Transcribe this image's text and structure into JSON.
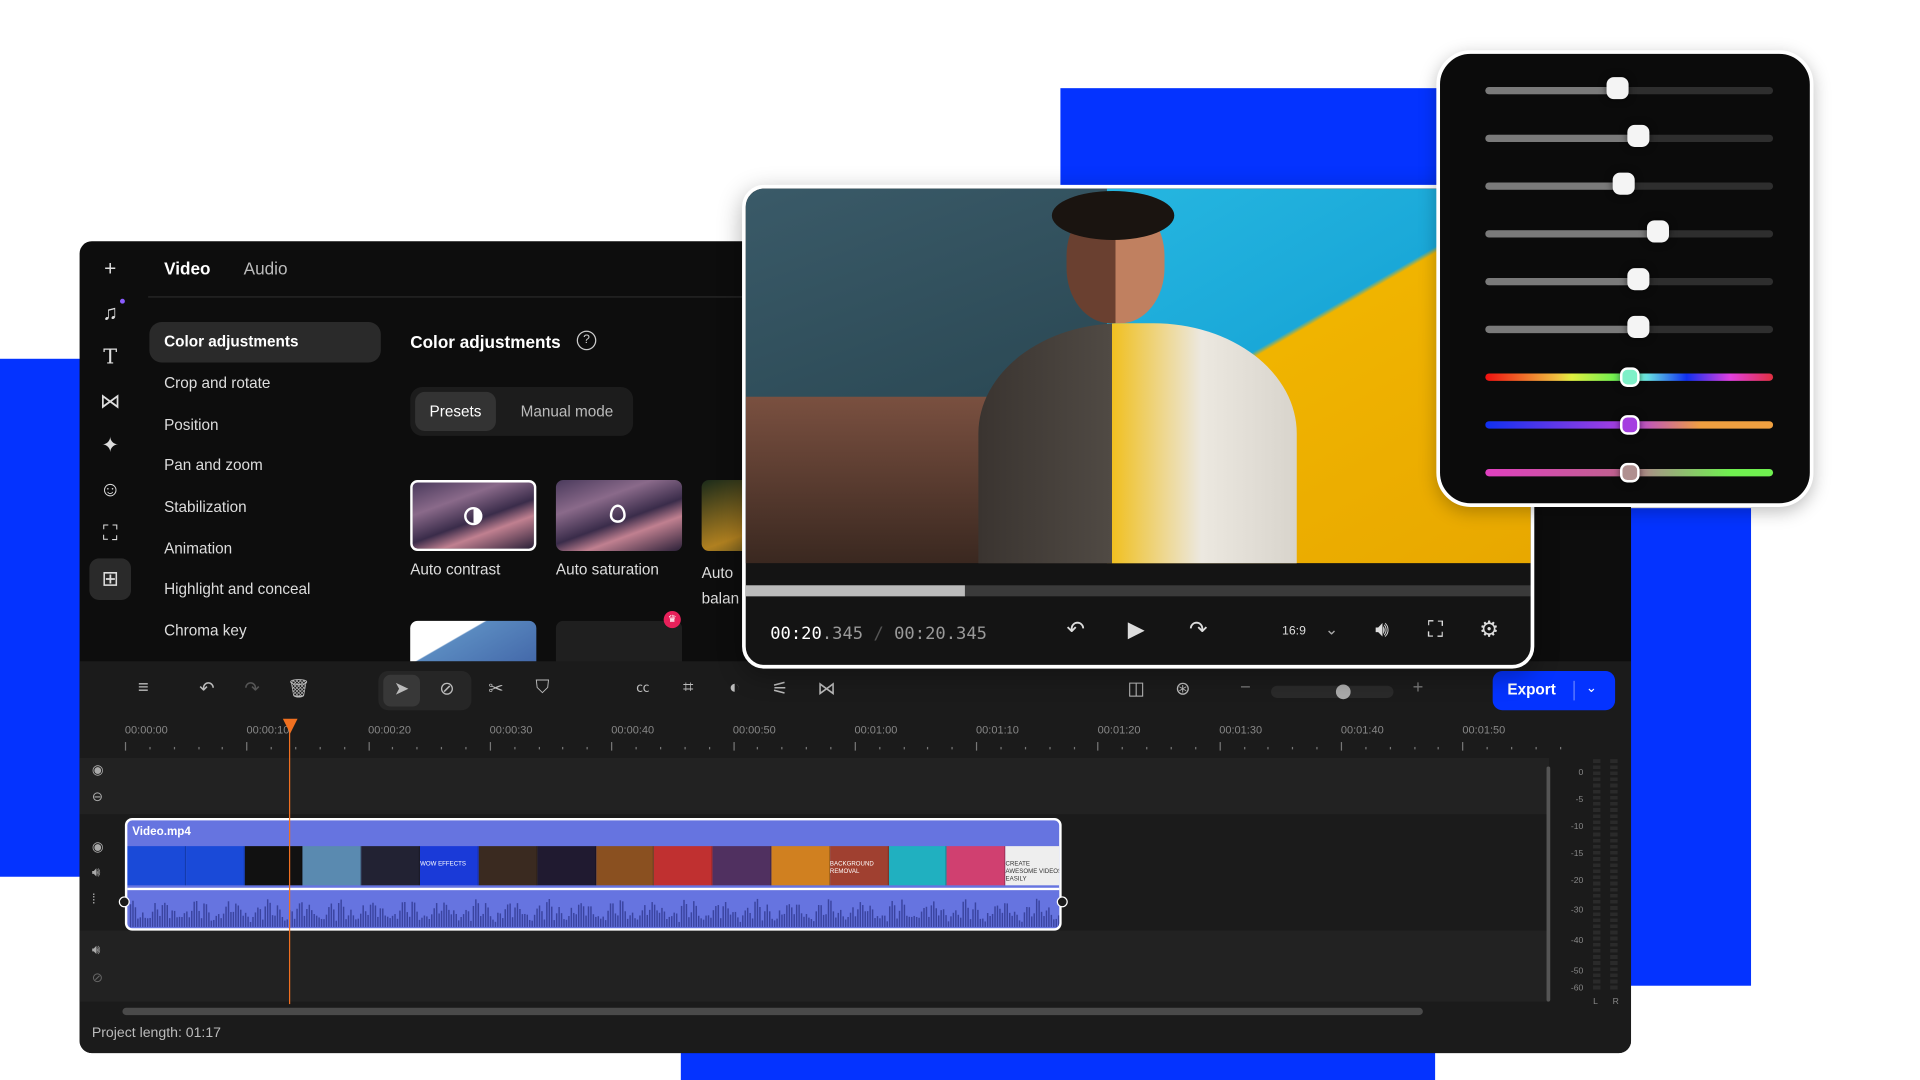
{
  "colors": {
    "brand_blue": "#0433ff",
    "export_button": "#0433ff",
    "clip": "#6674e0",
    "playhead": "#f07020",
    "panel_bg": "#0d0d0d"
  },
  "rail": {
    "icons": [
      "plus-icon",
      "music-icon",
      "text-icon",
      "transitions-icon",
      "effects-icon",
      "stickers-icon",
      "store-icon",
      "more-tools-icon"
    ],
    "active_index": 7
  },
  "tabs": [
    {
      "label": "Video",
      "active": true
    },
    {
      "label": "Audio",
      "active": false
    }
  ],
  "menu": {
    "items": [
      "Color adjustments",
      "Crop and rotate",
      "Position",
      "Pan and zoom",
      "Stabilization",
      "Animation",
      "Highlight and conceal",
      "Chroma key"
    ],
    "active_index": 0
  },
  "color_panel": {
    "title": "Color adjustments",
    "modes": [
      {
        "label": "Presets",
        "active": true
      },
      {
        "label": "Manual mode",
        "active": false
      }
    ],
    "presets": [
      {
        "label": "Auto contrast",
        "selected": true,
        "icon": "contrast-icon"
      },
      {
        "label": "Auto saturation",
        "selected": false,
        "icon": "drop-icon"
      },
      {
        "label": "Auto white balance",
        "visible_text": [
          "Auto ",
          "balan"
        ],
        "selected": false
      }
    ]
  },
  "player": {
    "current": "00:20",
    "current_ms": ".345",
    "separator": "/",
    "total": "00:20.345",
    "progress": 0.28,
    "aspect": "16:9"
  },
  "sliders": [
    {
      "value": 0.46,
      "type": "neutral"
    },
    {
      "value": 0.53,
      "type": "neutral"
    },
    {
      "value": 0.48,
      "type": "neutral"
    },
    {
      "value": 0.6,
      "type": "neutral"
    },
    {
      "value": 0.53,
      "type": "neutral"
    },
    {
      "value": 0.53,
      "type": "neutral"
    },
    {
      "value": 0.5,
      "type": "hue",
      "thumb": "#7ef0c8"
    },
    {
      "value": 0.5,
      "type": "blue-orange",
      "thumb": "#a53ee0"
    },
    {
      "value": 0.5,
      "type": "magenta-green",
      "thumb": "#b09090"
    }
  ],
  "toolbar": {
    "export_label": "Export",
    "zoom_level": 0.6
  },
  "ruler": [
    "00:00:00",
    "00:00:10",
    "00:00:20",
    "00:00:30",
    "00:00:40",
    "00:00:50",
    "00:01:00",
    "00:01:10",
    "00:01:20",
    "00:01:30",
    "00:01:40",
    "00:01:50"
  ],
  "playhead_time": "00:00:13",
  "clip": {
    "name": "Video.mp4",
    "thumb_texts": [
      "WOW EFFECTS",
      "BACKGROUND REMOVAL",
      "CREATE AWESOME VIDEOS EASILY"
    ]
  },
  "meter": {
    "labels": [
      "0",
      "-5",
      "-10",
      "-15",
      "-20",
      "-30",
      "-40",
      "-50",
      "-60"
    ],
    "channels": [
      "L",
      "R"
    ]
  },
  "footer": {
    "project_length": "Project length: 01:17"
  }
}
